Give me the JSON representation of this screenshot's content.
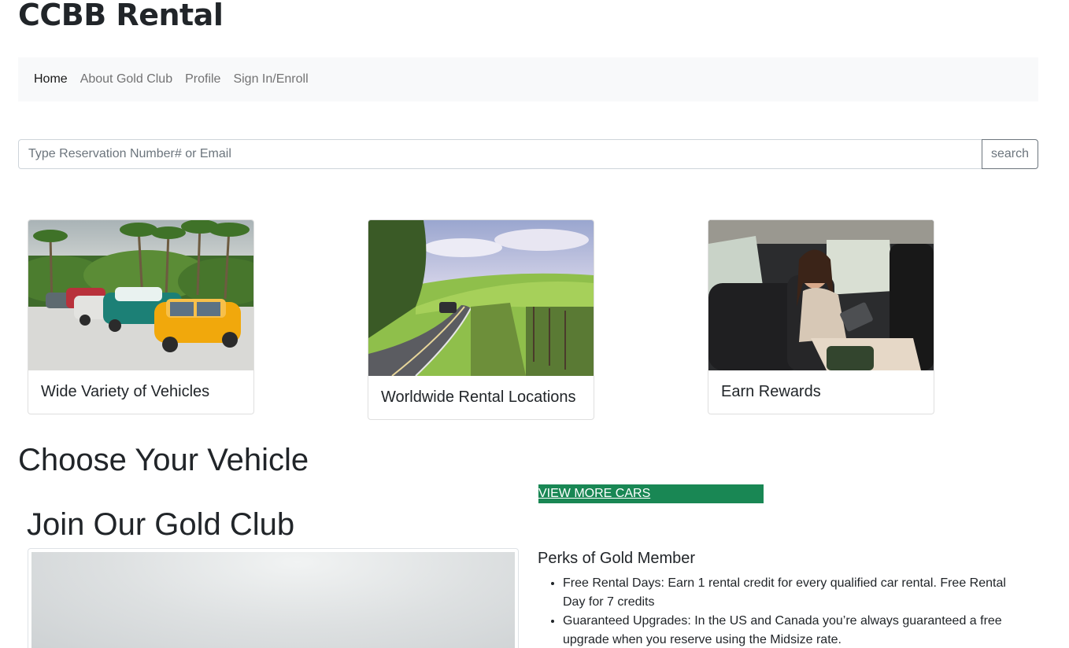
{
  "brand": {
    "title": "CCBB Rental"
  },
  "nav": {
    "items": [
      {
        "label": "Home",
        "active": true
      },
      {
        "label": "About Gold Club",
        "active": false
      },
      {
        "label": "Profile",
        "active": false
      },
      {
        "label": "Sign In/Enroll",
        "active": false
      }
    ]
  },
  "search": {
    "placeholder": "Type Reservation Number# or Email",
    "value": "",
    "button_label": "search"
  },
  "cards": [
    {
      "title": "Wide Variety of Vehicles",
      "image": "classic-cars-palm-trees"
    },
    {
      "title": "Worldwide Rental Locations",
      "image": "country-road-hills"
    },
    {
      "title": "Earn Rewards",
      "image": "woman-in-car-backseat"
    }
  ],
  "vehicles": {
    "heading": "Choose Your Vehicle",
    "view_more_label": "VIEW MORE CARS"
  },
  "gold_club": {
    "heading": "Join Our Gold Club",
    "perks_title": "Perks of Gold Member",
    "perks": [
      "Free Rental Days: Earn 1 rental credit for every qualified car rental. Free Rental Day for 7 credits",
      "Guaranteed Upgrades: In the US and Canada you’re always guaranteed a free upgrade when you reserve using the Midsize rate."
    ]
  },
  "colors": {
    "navbar_bg": "#f8f9fa",
    "view_more_bg": "#198754",
    "text": "#212529"
  }
}
